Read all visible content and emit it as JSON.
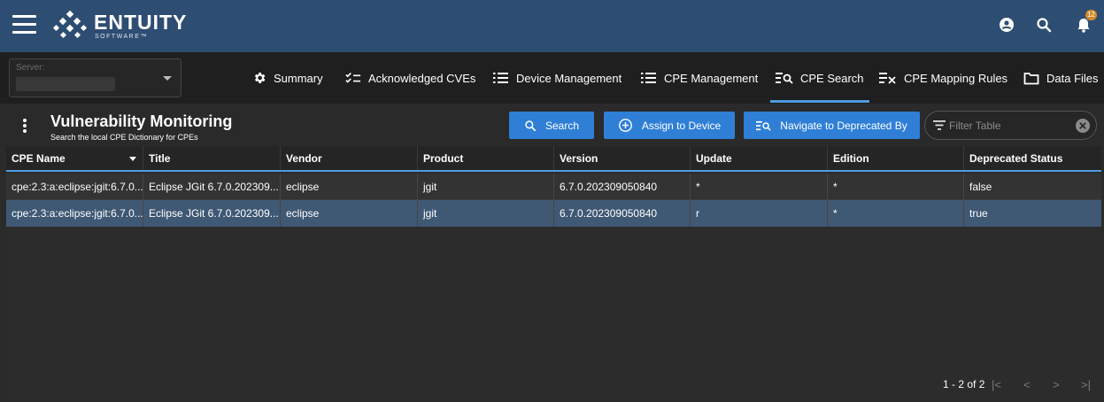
{
  "header": {
    "logo_text": "ENTUITY",
    "logo_sub": "SOFTWARE™",
    "icons": [
      "menu-icon",
      "account-icon",
      "search-icon",
      "notifications-icon"
    ],
    "notification_count": "12"
  },
  "server": {
    "label": "Server:",
    "value": ""
  },
  "nav": {
    "tabs": [
      {
        "label": "Summary",
        "icon": "gear-icon"
      },
      {
        "label": "Acknowledged CVEs",
        "icon": "checklist-icon"
      },
      {
        "label": "Device Management",
        "icon": "list-icon"
      },
      {
        "label": "CPE Management",
        "icon": "list-icon"
      },
      {
        "label": "CPE Search",
        "icon": "list-search-icon",
        "active": true
      },
      {
        "label": "CPE Mapping Rules",
        "icon": "list-remove-icon"
      },
      {
        "label": "Data Files",
        "icon": "folder-icon"
      }
    ]
  },
  "toolbar": {
    "title": "Vulnerability Monitoring",
    "subtitle": "Search the local CPE Dictionary for CPEs",
    "search_label": "Search",
    "assign_label": "Assign to Device",
    "navigate_label": "Navigate to Deprecated By",
    "filter_placeholder": "Filter Table"
  },
  "table": {
    "columns": [
      "CPE Name",
      "Title",
      "Vendor",
      "Product",
      "Version",
      "Update",
      "Edition",
      "Deprecated Status"
    ],
    "rows": [
      [
        "cpe:2.3:a:eclipse:jgit:6.7.0...",
        "Eclipse JGit 6.7.0.202309...",
        "eclipse",
        "jgit",
        "6.7.0.202309050840",
        "*",
        "*",
        "false"
      ],
      [
        "cpe:2.3:a:eclipse:jgit:6.7.0...",
        "Eclipse JGit 6.7.0.202309...",
        "eclipse",
        "jgit",
        "6.7.0.202309050840",
        "r",
        "*",
        "true"
      ]
    ],
    "selected_row": 1
  },
  "pagination": {
    "range": "1 - 2 of 2"
  },
  "colors": {
    "header_bg": "#2e4d72",
    "accent": "#2f7fd6",
    "active_tab_underline": "#4d9be0",
    "selected_row": "#3f5874"
  }
}
